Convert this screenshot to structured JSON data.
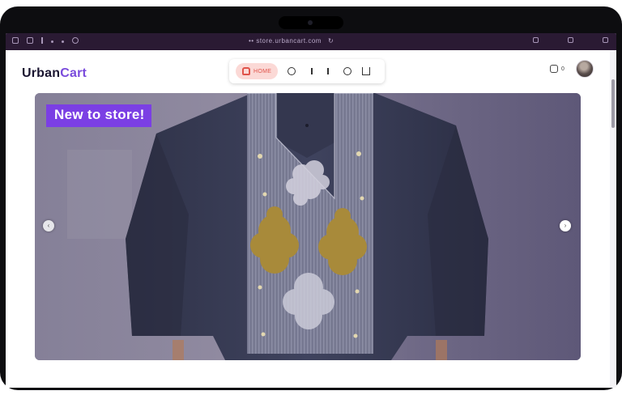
{
  "browser": {
    "url": "•• store.urbancart.com",
    "reload_symbol": "↻"
  },
  "header": {
    "logo_main": "Urban",
    "logo_accent": "Cart",
    "nav": {
      "home_label": "HOME",
      "items": [
        "info",
        "bar",
        "bar",
        "ring",
        "book"
      ]
    },
    "cart_count": "0"
  },
  "hero": {
    "badge": "New to store!",
    "prev_arrow": "‹",
    "next_arrow": "›"
  },
  "colors": {
    "brand_accent": "#7a4bdc",
    "badge_bg": "#7b3fe4",
    "home_pill_bg": "#fbd9d6",
    "home_pill_fg": "#e0534a",
    "garment": "#3b3f5a",
    "embroidery_gold": "#a88a3a"
  }
}
